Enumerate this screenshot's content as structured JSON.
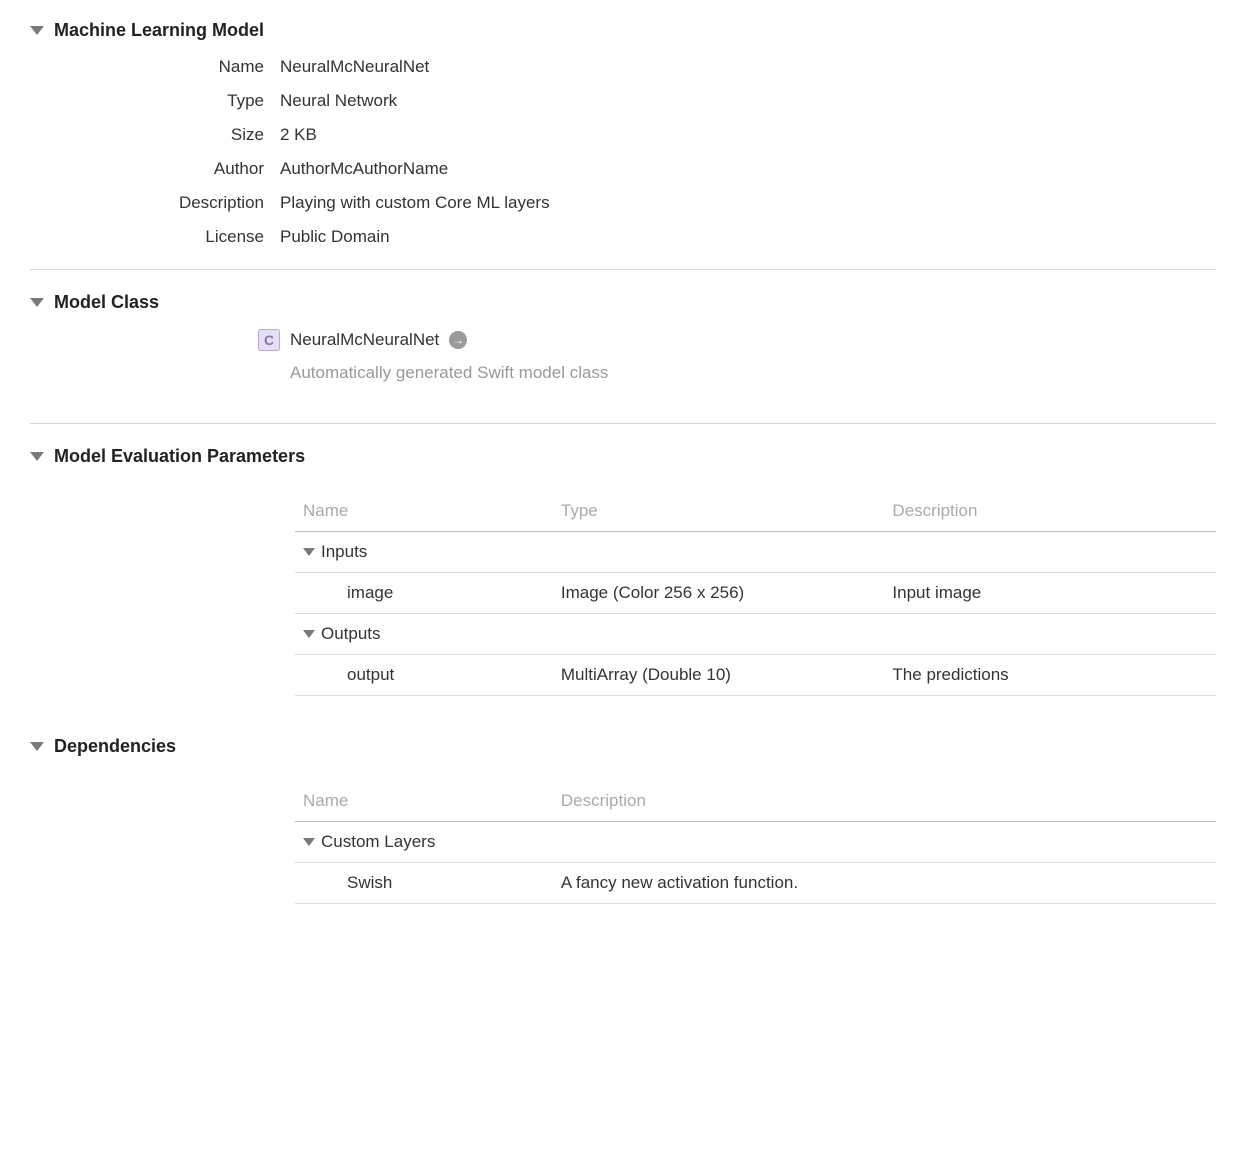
{
  "sections": {
    "ml_model": {
      "title": "Machine Learning Model",
      "fields": {
        "name_label": "Name",
        "name_value": "NeuralMcNeuralNet",
        "type_label": "Type",
        "type_value": "Neural Network",
        "size_label": "Size",
        "size_value": "2 KB",
        "author_label": "Author",
        "author_value": "AuthorMcAuthorName",
        "description_label": "Description",
        "description_value": "Playing with custom Core ML layers",
        "license_label": "License",
        "license_value": "Public Domain"
      }
    },
    "model_class": {
      "title": "Model Class",
      "class_icon_letter": "C",
      "class_name": "NeuralMcNeuralNet",
      "class_description": "Automatically generated Swift model class"
    },
    "eval_params": {
      "title": "Model Evaluation Parameters",
      "columns": {
        "name": "Name",
        "type": "Type",
        "description": "Description"
      },
      "inputs_group": "Inputs",
      "outputs_group": "Outputs",
      "inputs": [
        {
          "name": "image",
          "type": "Image (Color 256 x 256)",
          "description": "Input image"
        }
      ],
      "outputs": [
        {
          "name": "output",
          "type": "MultiArray (Double 10)",
          "description": "The predictions"
        }
      ]
    },
    "dependencies": {
      "title": "Dependencies",
      "columns": {
        "name": "Name",
        "description": "Description"
      },
      "custom_layers_group": "Custom Layers",
      "custom_layers": [
        {
          "name": "Swish",
          "description": "A fancy new activation function."
        }
      ]
    }
  }
}
